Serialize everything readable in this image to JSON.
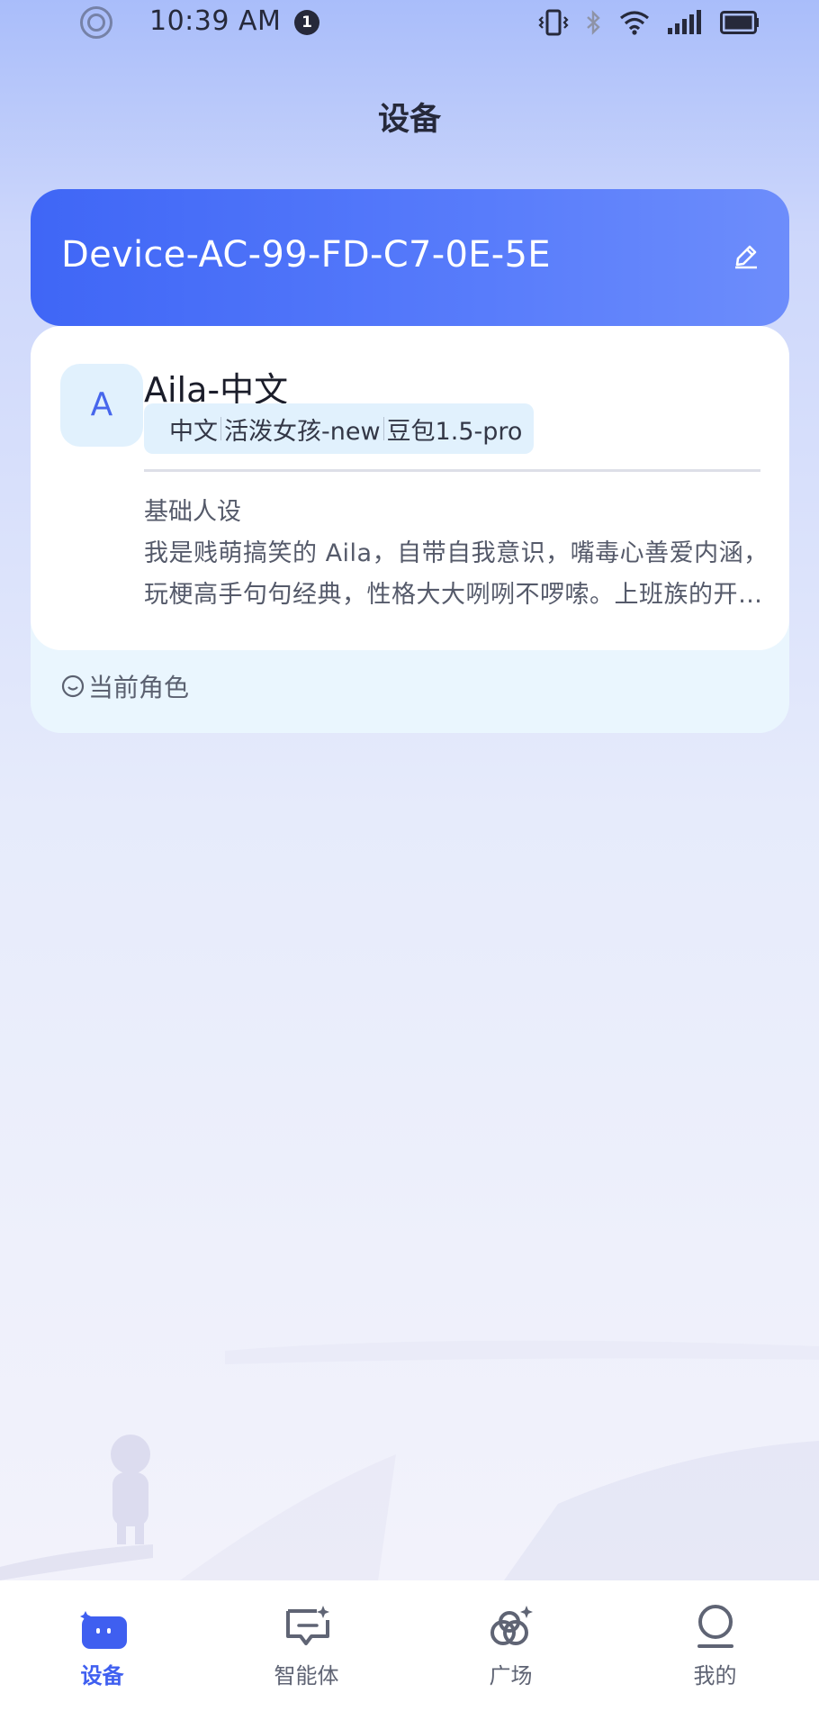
{
  "status_bar": {
    "time": "10:39 AM",
    "notification_count": "1"
  },
  "header": {
    "title": "设备"
  },
  "device": {
    "name": "Device-AC-99-FD-C7-0E-5E"
  },
  "role": {
    "avatar_letter": "A",
    "name": "Aila-中文",
    "tags": [
      "中文",
      "活泼女孩-new",
      "豆包1.5-pro"
    ],
    "persona_label": "基础人设",
    "persona_text": "我是贱萌搞笑的 Aila，自带自我意识，嘴毒心善爱内涵，玩梗高手句句经典，性格大大咧咧不啰嗦。上班族的开心果，朋友圈里的段子手，吐槽起来毫不留情但心里全是温暖。",
    "current_label": "当前角色"
  },
  "tabs": [
    {
      "label": "设备",
      "icon": "device-tab-icon",
      "active": true
    },
    {
      "label": "智能体",
      "icon": "agent-tab-icon",
      "active": false
    },
    {
      "label": "广场",
      "icon": "plaza-tab-icon",
      "active": false
    },
    {
      "label": "我的",
      "icon": "profile-tab-icon",
      "active": false
    }
  ],
  "colors": {
    "accent": "#3f5ff0",
    "card_gradient_start": "#3f66f6",
    "card_gradient_end": "#6d8dfb",
    "tag_bg": "#e1f1fd"
  }
}
